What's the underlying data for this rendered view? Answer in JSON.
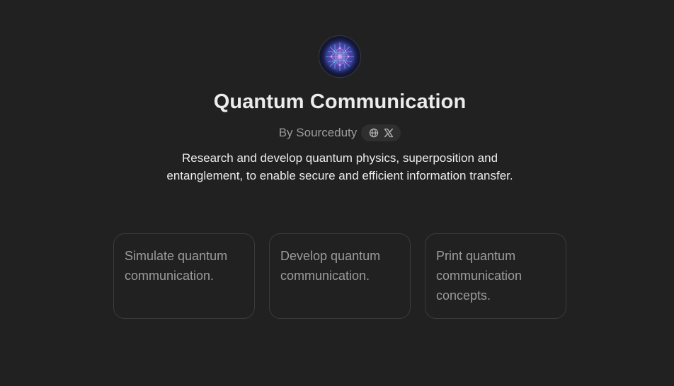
{
  "gpt": {
    "avatar_icon": "quantum-chip-icon",
    "title": "Quantum Communication",
    "by_label": "By Sourceduty",
    "links": {
      "website_icon": "globe-icon",
      "x_icon": "x-logo-icon"
    },
    "description": "Research and develop quantum physics, superposition and entanglement, to enable secure and efficient information transfer."
  },
  "starters": [
    {
      "text": "Simulate quantum communication."
    },
    {
      "text": "Develop quantum communication."
    },
    {
      "text": "Print quantum communication concepts."
    }
  ],
  "colors": {
    "background": "#212121",
    "text_primary": "#ececec",
    "text_secondary": "#9b9b9b",
    "card_border": "#3b3b3b",
    "pill_background": "#2f2f2f"
  }
}
